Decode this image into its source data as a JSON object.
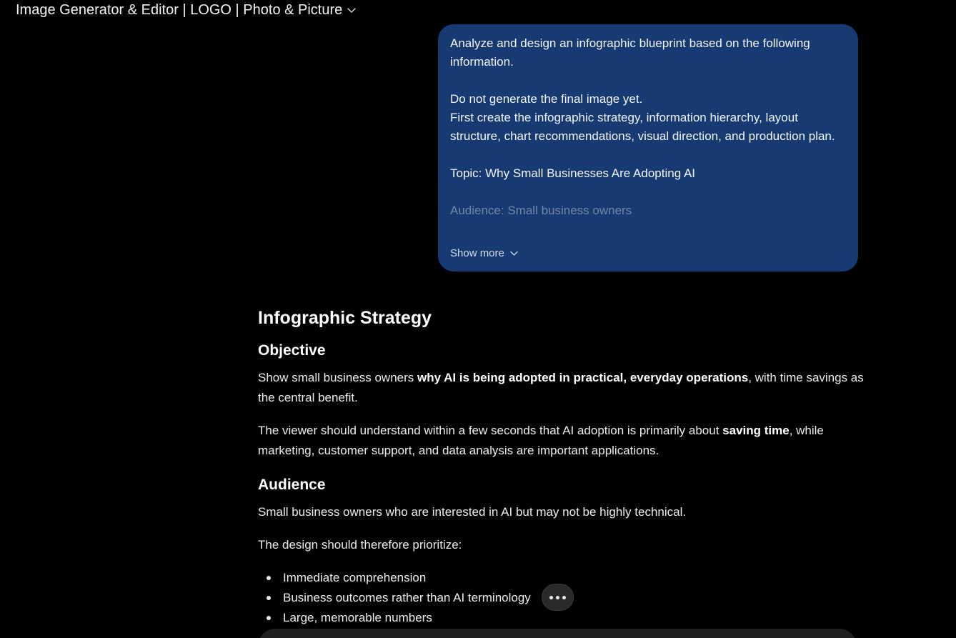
{
  "header": {
    "title": "Image Generator & Editor | LOGO | Photo & Picture"
  },
  "user_message": {
    "lines": [
      "Analyze and design an infographic blueprint based on the following information.",
      "",
      "Do not generate the final image yet.",
      "First create the infographic strategy, information hierarchy, layout structure, chart recommendations, visual direction, and production plan.",
      "",
      "Topic: Why Small Businesses Are Adopting AI",
      ""
    ],
    "faded_line": "Audience: Small business owners",
    "show_more_label": "Show more",
    "bubble_color": "#173a73"
  },
  "response": {
    "title": "Infographic Strategy",
    "objective": {
      "heading": "Objective",
      "para1_pre": "Show small business owners ",
      "para1_bold": "why AI is being adopted in practical, everyday operations",
      "para1_post": ", with time savings as the central benefit.",
      "para2_pre": "The viewer should understand within a few seconds that AI adoption is primarily about ",
      "para2_bold": "saving time",
      "para2_post": ", while marketing, customer support, and data analysis are important applications."
    },
    "audience": {
      "heading": "Audience",
      "para1": "Small business owners who are interested in AI but may not be highly technical.",
      "para2": "The design should therefore prioritize:",
      "bullets": [
        "Immediate comprehension",
        "Business outcomes rather than AI terminology",
        "Large, memorable numbers"
      ]
    }
  },
  "icons": {
    "header_chevron": "chevron-down-icon",
    "show_more_chevron": "chevron-down-icon",
    "more_button": "ellipsis-icon"
  }
}
